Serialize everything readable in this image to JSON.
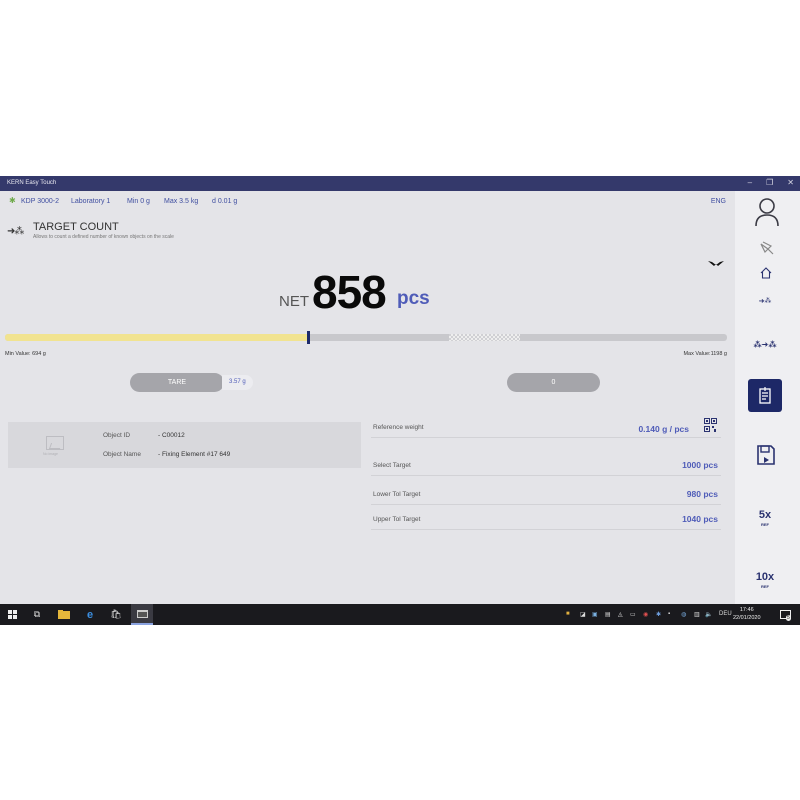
{
  "window": {
    "title": "KERN Easy Touch",
    "minimize": "–",
    "maximize": "❐",
    "close": "✕"
  },
  "infobar": {
    "model": "KDP 3000-2",
    "location": "Laboratory 1",
    "min": "Min 0 g",
    "max": "Max 3.5 kg",
    "division": "d 0.01 g",
    "language": "ENG"
  },
  "mode": {
    "title": "TARGET COUNT",
    "description": "Allows to count a defined number of known objects on the scale"
  },
  "readout": {
    "label": "NET",
    "value": "858",
    "unit": "pcs"
  },
  "progress": {
    "fraction": 0.42,
    "target_start_fraction": 0.615,
    "target_end_fraction": 0.713,
    "min_label": "Min Value: 694 g",
    "max_label": "Max Value:1198 g"
  },
  "tare": {
    "label": "TARE",
    "value": "3.57 g"
  },
  "zero": {
    "label": "0"
  },
  "object": {
    "image_caption": "No image",
    "id_label": "Object ID",
    "id_value": "- C00012",
    "name_label": "Object Name",
    "name_value": "- Fixing Element #17 649"
  },
  "params": [
    {
      "label": "Reference weight",
      "value": "0.140  g / pcs"
    },
    {
      "label": "Select Target",
      "value": "1000 pcs"
    },
    {
      "label": "Lower Tol Target",
      "value": "980 pcs"
    },
    {
      "label": "Upper Tol Target",
      "value": "1040 pcs"
    }
  ],
  "sidebar": {
    "ref5": {
      "main": "5x",
      "sub": "REF"
    },
    "ref10": {
      "main": "10x",
      "sub": "REF"
    }
  },
  "taskbar": {
    "language": "DEU",
    "time": "17:46",
    "date": "22/01/2020",
    "notifications": "5"
  },
  "colors": {
    "accent": "#4f5cb8",
    "titlebar": "#34396b",
    "active": "#1d2867",
    "progress": "#f1e390"
  }
}
